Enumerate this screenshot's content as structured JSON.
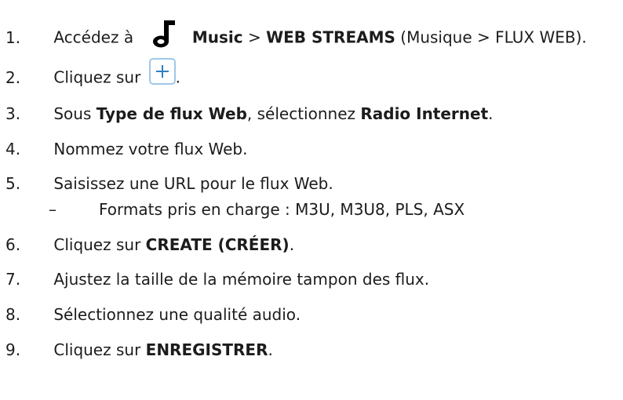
{
  "steps": [
    {
      "num": "1.",
      "parts": [
        "Accédez à ",
        "Music",
        " > ",
        "WEB STREAMS",
        " (Musique > FLUX WEB)."
      ],
      "icon": "music-note-icon"
    },
    {
      "num": "2.",
      "parts": [
        "Cliquez sur ",
        "."
      ],
      "icon": "add-plus-icon"
    },
    {
      "num": "3.",
      "parts": [
        "Sous ",
        "Type de flux Web",
        ", sélectionnez ",
        "Radio Internet",
        "."
      ]
    },
    {
      "num": "4.",
      "parts": [
        "Nommez votre flux Web."
      ]
    },
    {
      "num": "5.",
      "parts": [
        "Saisissez une URL pour le flux Web."
      ]
    },
    {
      "num": "6.",
      "parts": [
        "Cliquez sur ",
        "CREATE (CRÉER)",
        "."
      ]
    },
    {
      "num": "7.",
      "parts": [
        "Ajustez la taille de la mémoire tampon des flux."
      ]
    },
    {
      "num": "8.",
      "parts": [
        "Sélectionnez une qualité audio."
      ]
    },
    {
      "num": "9.",
      "parts": [
        "Cliquez sur ",
        "ENREGISTRER",
        "."
      ]
    }
  ],
  "sub_item": {
    "dash": "–",
    "text": "Formats pris en charge : M3U, M3U8, PLS, ASX"
  },
  "colors": {
    "text": "#1c1c1c",
    "button_border": "#9ec7ea",
    "plus": "#2f7fc1"
  }
}
